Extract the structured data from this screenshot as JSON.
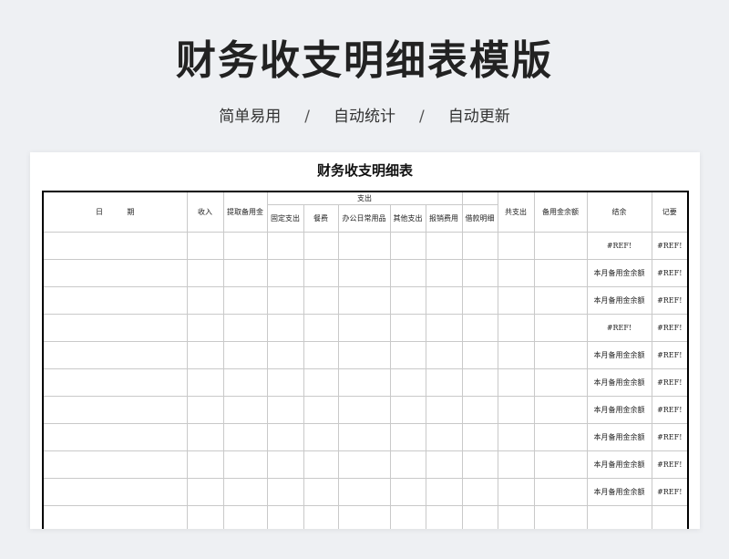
{
  "hero": {
    "title": "财务收支明细表模版",
    "tags": [
      "简单易用",
      "自动统计",
      "自动更新"
    ],
    "separator": "/"
  },
  "sheet": {
    "title": "财务收支明细表",
    "headers": {
      "date": "日 期",
      "income": "收入",
      "withdraw": "提取备用金",
      "expense_group": "支出",
      "expense_sub": [
        "固定支出",
        "餐费",
        "办公日常用品",
        "其他支出",
        "报销费用"
      ],
      "loan": "借款明细",
      "total": "共支出",
      "reserve_balance": "备用金余额",
      "balance": "结余",
      "notes": "记要"
    },
    "rows": [
      {
        "balance": "#REF!",
        "notes": "#REF!"
      },
      {
        "balance": "本月备用金余额",
        "notes": "#REF!"
      },
      {
        "balance": "本月备用金余额",
        "notes": "#REF!"
      },
      {
        "balance": "#REF!",
        "notes": "#REF!"
      },
      {
        "balance": "本月备用金余额",
        "notes": "#REF!"
      },
      {
        "balance": "本月备用金余额",
        "notes": "#REF!"
      },
      {
        "balance": "本月备用金余额",
        "notes": "#REF!"
      },
      {
        "balance": "本月备用金余额",
        "notes": "#REF!"
      },
      {
        "balance": "本月备用金余额",
        "notes": "#REF!"
      },
      {
        "balance": "本月备用金余额",
        "notes": "#REF!"
      },
      {
        "balance": "",
        "notes": ""
      }
    ]
  },
  "colors": {
    "page_background": "#eef0f3",
    "sheet_background": "#ffffff",
    "grid_line": "#c9c9c9",
    "frame": "#000000"
  }
}
